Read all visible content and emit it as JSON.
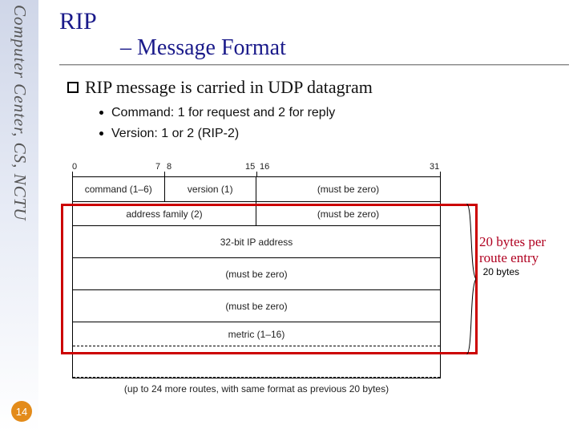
{
  "sidebar": {
    "org_text": "Computer Center, CS, NCTU"
  },
  "page_number": "14",
  "title": {
    "line1": "RIP",
    "line2": "– Message Format"
  },
  "bullet": "RIP message is carried in UDP datagram",
  "subs": [
    "Command: 1 for request and 2 for reply",
    "Version: 1 or 2 (RIP-2)"
  ],
  "bits": {
    "b0": "0",
    "b7": "7",
    "b8": "8",
    "b15": "15",
    "b16": "16",
    "b31": "31"
  },
  "rows": {
    "r1c1": "command (1–6)",
    "r1c2": "version (1)",
    "r1c3": "(must be zero)",
    "r2c1": "address family (2)",
    "r2c2": "(must be zero)",
    "r3": "32-bit IP address",
    "r4": "(must be zero)",
    "r5": "(must be zero)",
    "r6": "metric (1–16)"
  },
  "brace_label": "20 bytes",
  "annotation": "20 bytes per route entry",
  "footer_note": "(up to 24 more routes, with same format as previous 20 bytes)"
}
